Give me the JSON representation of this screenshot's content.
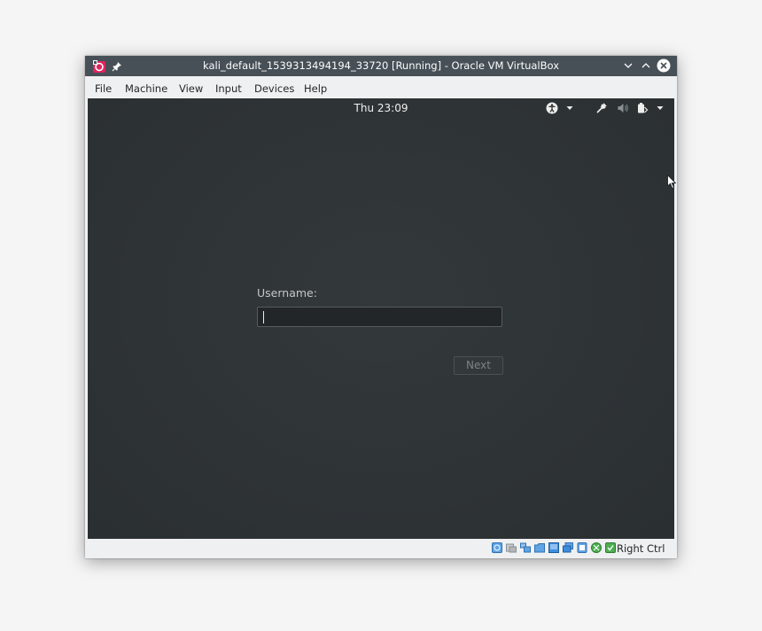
{
  "window": {
    "title": "kali_default_1539313494194_33720 [Running] - Oracle VM VirtualBox",
    "app_icon": "virtualbox-icon",
    "controls": [
      "pin-icon",
      "minimize-icon",
      "maximize-icon",
      "close-icon"
    ]
  },
  "menu": {
    "items": [
      {
        "label": "File"
      },
      {
        "label": "Machine"
      },
      {
        "label": "View"
      },
      {
        "label": "Input"
      },
      {
        "label": "Devices"
      },
      {
        "label": "Help"
      }
    ]
  },
  "guest": {
    "clock": "Thu 23:09",
    "top_icons": [
      "accessibility-icon",
      "chevron-down-icon",
      "network-icon",
      "volume-icon",
      "power-icon",
      "chevron-down-icon"
    ],
    "login": {
      "username_label": "Username:",
      "username_value": "",
      "next_label": "Next"
    }
  },
  "statusbar": {
    "icons": [
      "hard-disk-icon",
      "optical-drive-icon",
      "audio-icon",
      "network-icon",
      "usb-icon",
      "shared-folders-icon",
      "display-icon",
      "video-capture-icon",
      "cpu-icon",
      "mouse-integration-icon"
    ],
    "host_key": "Right Ctrl"
  },
  "colors": {
    "titlebar": "#475057",
    "guest_background": "#2e3436",
    "chrome": "#eff0f1",
    "status_accent": "#3d8ee0"
  }
}
